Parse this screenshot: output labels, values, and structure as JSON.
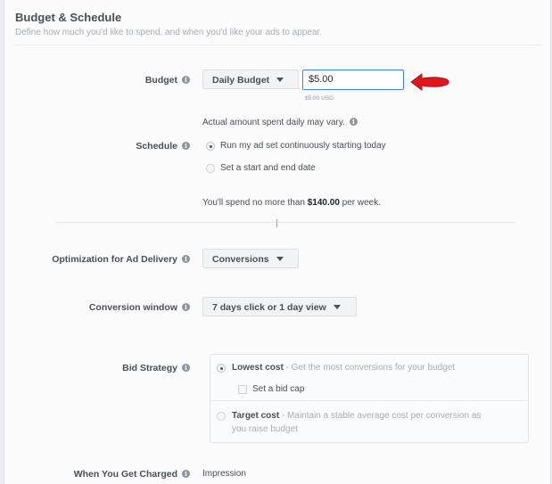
{
  "header": {
    "title": "Budget & Schedule",
    "subtitle": "Define how much you'd like to spend, and when you'd like your ads to appear."
  },
  "budget": {
    "label": "Budget",
    "type": "Daily Budget",
    "value": "$5.00",
    "converted": "$5.00 USD",
    "note": "Actual amount spent daily may vary."
  },
  "schedule": {
    "label": "Schedule",
    "options": [
      {
        "text": "Run my ad set continuously starting today",
        "selected": true
      },
      {
        "text": "Set a start and end date",
        "selected": false
      }
    ],
    "summary_prefix": "You'll spend no more than ",
    "summary_amount": "$140.00",
    "summary_suffix": " per week."
  },
  "optimization": {
    "label": "Optimization for Ad Delivery",
    "value": "Conversions"
  },
  "conversion_window": {
    "label": "Conversion window",
    "value": "7 days click or 1 day view"
  },
  "bid_strategy": {
    "label": "Bid Strategy",
    "lowest_cost": {
      "title": "Lowest cost",
      "desc": " - Get the most conversions for your budget",
      "selected": true
    },
    "bid_cap": "Set a bid cap",
    "target_cost": {
      "title": "Target cost",
      "desc_line1": " - Maintain a stable average cost per conversion as",
      "desc_line2": "you raise budget",
      "selected": false
    }
  },
  "charged": {
    "label": "When You Get Charged",
    "value": "Impression"
  },
  "colors": {
    "accent": "#4080ff",
    "arrow": "#e0161c"
  }
}
